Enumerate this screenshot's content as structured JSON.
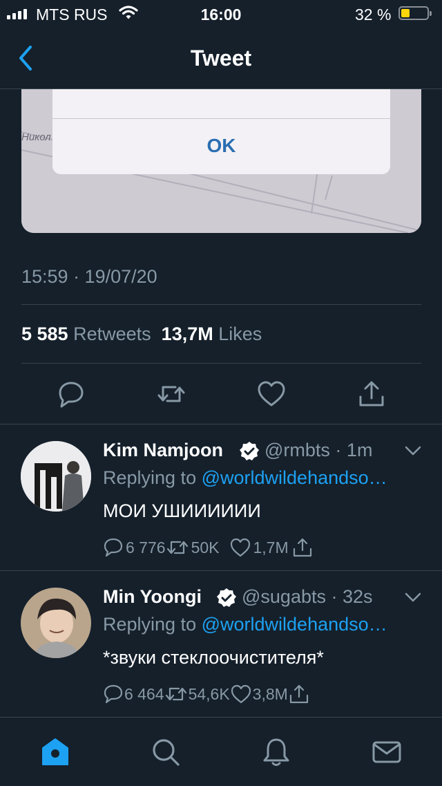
{
  "status_bar": {
    "carrier": "MTS RUS",
    "time": "16:00",
    "battery_percent": "32 %",
    "battery_level": 0.32,
    "icons": [
      "signal-icon",
      "wifi-icon",
      "battery-icon"
    ]
  },
  "header": {
    "title": "Tweet",
    "back_icon": "chevron-left-icon"
  },
  "media": {
    "dialog_button": "OK",
    "map_label": "Никол"
  },
  "tweet": {
    "timestamp": "15:59 · 19/07/20",
    "retweets_count": "5 585",
    "retweets_label": "Retweets",
    "likes_count": "13,7M",
    "likes_label": "Likes",
    "actions": [
      "reply-icon",
      "retweet-icon",
      "like-icon",
      "share-icon"
    ]
  },
  "replies": [
    {
      "name": "Kim Namjoon",
      "handle": "@rmbts",
      "time": "1m",
      "replying_prefix": "Replying to",
      "replying_to": "@worldwildehandso…",
      "text": "МОИ УШИИИИИИ",
      "replies": "6 776",
      "retweets": "50K",
      "likes": "1,7M"
    },
    {
      "name": "Min Yoongi",
      "handle": "@sugabts",
      "time": "32s",
      "replying_prefix": "Replying to",
      "replying_to": "@worldwildehandso…",
      "text": "*звуки стеклоочистителя*",
      "replies": "6 464",
      "retweets": "54,6K",
      "likes": "3,8M"
    }
  ],
  "tab_bar": {
    "tabs": [
      "home-icon",
      "search-icon",
      "notifications-icon",
      "messages-icon"
    ],
    "active_color": "#1da1f2"
  },
  "colors": {
    "background": "#15202b",
    "secondary_text": "#8899a6",
    "accent": "#1da1f2",
    "divider": "#38444d"
  }
}
